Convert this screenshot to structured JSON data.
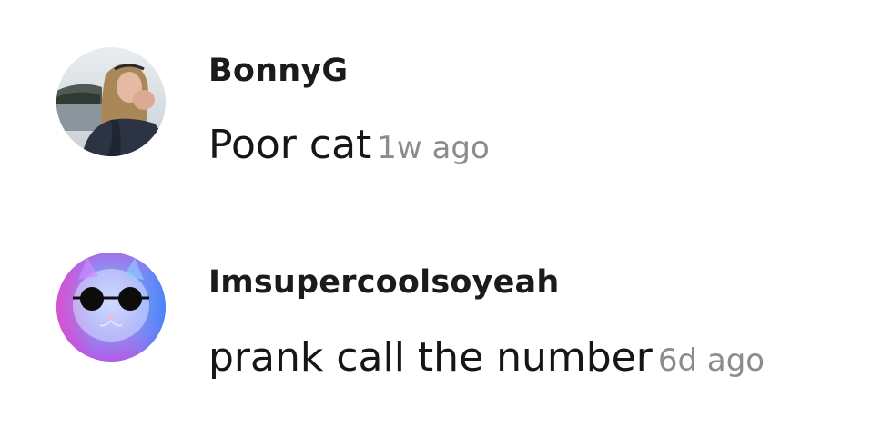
{
  "comments": [
    {
      "username": "BonnyG",
      "text": "Poor cat",
      "time": "1w ago",
      "avatar_icon": "profile-photo-woman"
    },
    {
      "username": "Imsupercoolsoyeah",
      "text": "prank call the number",
      "time": "6d ago",
      "avatar_icon": "profile-photo-cat-sunglasses"
    }
  ],
  "colors": {
    "username": "#1b1b1b",
    "text": "#161616",
    "timestamp": "#8c8c8c",
    "background": "#ffffff"
  }
}
